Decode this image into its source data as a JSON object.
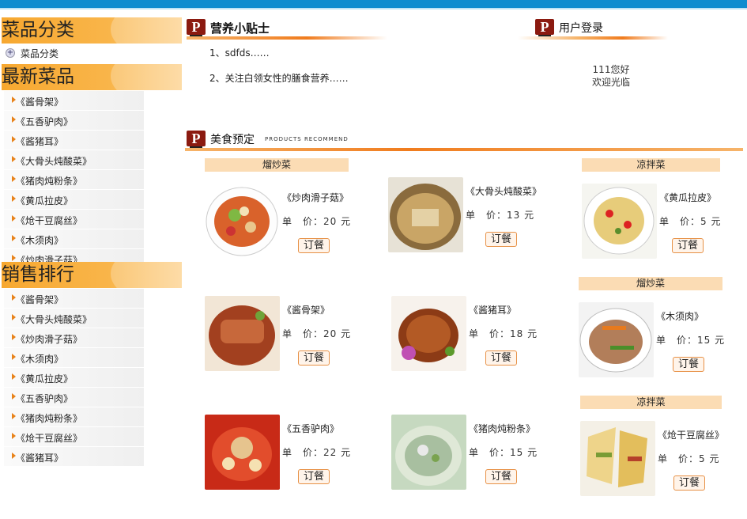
{
  "sidebar": {
    "category_title": "菜品分类",
    "category_link": "菜品分类",
    "newest_title": "最新菜品",
    "newest_items": [
      "《酱骨架》",
      "《五香驴肉》",
      "《酱猪耳》",
      "《大骨头炖酸菜》",
      "《猪肉炖粉条》",
      "《黄瓜拉皮》",
      "《炝干豆腐丝》",
      "《木须肉》",
      "《炒肉滑子菇》"
    ],
    "ranking_title": "销售排行",
    "ranking_items": [
      "《酱骨架》",
      "《大骨头炖酸菜》",
      "《炒肉滑子菇》",
      "《木须肉》",
      "《黄瓜拉皮》",
      "《五香驴肉》",
      "《猪肉炖粉条》",
      "《炝干豆腐丝》",
      "《酱猪耳》"
    ]
  },
  "tips": {
    "title": "营养小贴士",
    "items": [
      "1、sdfds……",
      "2、关注白领女性的膳食营养……"
    ]
  },
  "login": {
    "title": "用户登录",
    "greeting": "111您好",
    "welcome": "欢迎光临"
  },
  "booking": {
    "title": "美食预定",
    "subtitle": "PRODUCTS RECOMMEND",
    "tags": [
      "熘炒菜",
      "凉拌菜",
      "熘炒菜",
      "凉拌菜"
    ],
    "price_label": "单　价：",
    "order_label": "订餐",
    "dishes": [
      {
        "name": "《炒肉滑子菇》",
        "price": "20 元"
      },
      {
        "name": "《大骨头炖酸菜》",
        "price": "13 元"
      },
      {
        "name": "《黄瓜拉皮》",
        "price": "5 元"
      },
      {
        "name": "《酱骨架》",
        "price": "20 元"
      },
      {
        "name": "《酱猪耳》",
        "price": "18 元"
      },
      {
        "name": "《木须肉》",
        "price": "15 元"
      },
      {
        "name": "《五香驴肉》",
        "price": "22 元"
      },
      {
        "name": "《猪肉炖粉条》",
        "price": "15 元"
      },
      {
        "name": "《炝干豆腐丝》",
        "price": "5 元"
      }
    ]
  },
  "colors": {
    "accent": "#f7a830",
    "topbar": "#0f8ccf",
    "logo": "#8b1a10",
    "tag": "#fbdcb4"
  }
}
